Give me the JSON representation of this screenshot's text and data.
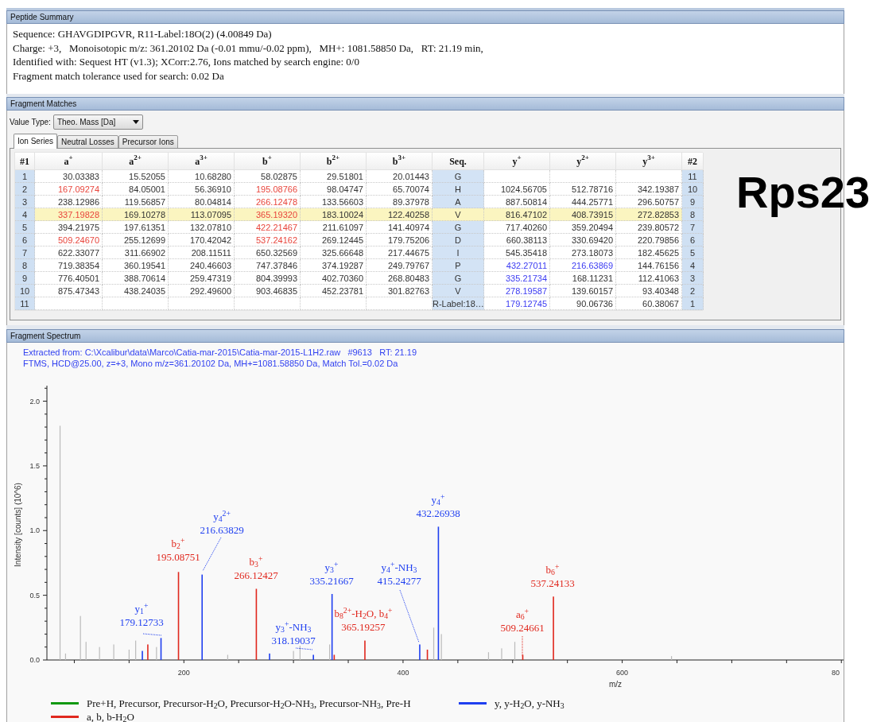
{
  "peptide_summary": {
    "title": "Peptide Summary",
    "lines": [
      "Sequence: GHAVGDIPGVR, R11-Label:18O(2) (4.00849 Da)",
      "Charge: +3,   Monoisotopic m/z: 361.20102 Da (-0.01 mmu/-0.02 ppm),   MH+: 1081.58850 Da,   RT: 21.19 min,",
      "Identified with: Sequest HT (v1.3); XCorr:2.76, Ions matched by search engine: 0/0",
      "Fragment match tolerance used for search: 0.02 Da"
    ]
  },
  "fragment_matches": {
    "title": "Fragment Matches",
    "value_type": {
      "label": "Value Type:",
      "value": "Theo. Mass [Da]"
    },
    "tabs": [
      {
        "label": "Ion Series",
        "selected": true
      },
      {
        "label": "Neutral Losses",
        "selected": false
      },
      {
        "label": "Precursor Ions",
        "selected": false
      }
    ],
    "table": {
      "columns": [
        {
          "label": "#1",
          "kind": "index"
        },
        {
          "label": "a$^{+}$",
          "kind": "a"
        },
        {
          "label": "a$^{2+}$",
          "kind": "a"
        },
        {
          "label": "a$^{3+}$",
          "kind": "a"
        },
        {
          "label": "b$^{+}$",
          "kind": "b"
        },
        {
          "label": "b$^{2+}$",
          "kind": "b"
        },
        {
          "label": "b$^{3+}$",
          "kind": "b"
        },
        {
          "label": "Seq.",
          "kind": "seq"
        },
        {
          "label": "y$^{+}$",
          "kind": "y"
        },
        {
          "label": "y$^{2+}$",
          "kind": "y"
        },
        {
          "label": "y$^{3+}$",
          "kind": "y"
        },
        {
          "label": "#2",
          "kind": "index"
        }
      ],
      "rows": [
        {
          "number": "1",
          "selected": false,
          "a": [
            {
              "value": "30.03383",
              "matched": false
            },
            {
              "value": "15.52055",
              "matched": false
            },
            {
              "value": "10.68280",
              "matched": false
            }
          ],
          "b": [
            {
              "value": "58.02875",
              "matched": false
            },
            {
              "value": "29.51801",
              "matched": false
            },
            {
              "value": "20.01443",
              "matched": false
            }
          ],
          "seq": "G",
          "number_rev": "11"
        },
        {
          "number": "2",
          "selected": false,
          "a": [
            {
              "value": "167.09274",
              "matched": true
            },
            {
              "value": "84.05001",
              "matched": false
            },
            {
              "value": "56.36910",
              "matched": false
            }
          ],
          "b": [
            {
              "value": "195.08766",
              "matched": true
            },
            {
              "value": "98.04747",
              "matched": false
            },
            {
              "value": "65.70074",
              "matched": false
            }
          ],
          "seq": "H",
          "y": [
            {
              "value": "1024.56705",
              "matched": false
            },
            {
              "value": "512.78716",
              "matched": false
            },
            {
              "value": "342.19387",
              "matched": false
            }
          ],
          "number_rev": "10"
        },
        {
          "number": "3",
          "selected": false,
          "a": [
            {
              "value": "238.12986",
              "matched": false
            },
            {
              "value": "119.56857",
              "matched": false
            },
            {
              "value": "80.04814",
              "matched": false
            }
          ],
          "b": [
            {
              "value": "266.12478",
              "matched": true
            },
            {
              "value": "133.56603",
              "matched": false
            },
            {
              "value": "89.37978",
              "matched": false
            }
          ],
          "seq": "A",
          "y": [
            {
              "value": "887.50814",
              "matched": false
            },
            {
              "value": "444.25771",
              "matched": false
            },
            {
              "value": "296.50757",
              "matched": false
            }
          ],
          "number_rev": "9"
        },
        {
          "number": "4",
          "selected": true,
          "a": [
            {
              "value": "337.19828",
              "matched": true
            },
            {
              "value": "169.10278",
              "matched": false
            },
            {
              "value": "113.07095",
              "matched": false
            }
          ],
          "b": [
            {
              "value": "365.19320",
              "matched": true
            },
            {
              "value": "183.10024",
              "matched": false
            },
            {
              "value": "122.40258",
              "matched": false
            }
          ],
          "seq": "V",
          "y": [
            {
              "value": "816.47102",
              "matched": false
            },
            {
              "value": "408.73915",
              "matched": false
            },
            {
              "value": "272.82853",
              "matched": false
            }
          ],
          "number_rev": "8"
        },
        {
          "number": "5",
          "selected": false,
          "a": [
            {
              "value": "394.21975",
              "matched": false
            },
            {
              "value": "197.61351",
              "matched": false
            },
            {
              "value": "132.07810",
              "matched": false
            }
          ],
          "b": [
            {
              "value": "422.21467",
              "matched": true
            },
            {
              "value": "211.61097",
              "matched": false
            },
            {
              "value": "141.40974",
              "matched": false
            }
          ],
          "seq": "G",
          "y": [
            {
              "value": "717.40260",
              "matched": false
            },
            {
              "value": "359.20494",
              "matched": false
            },
            {
              "value": "239.80572",
              "matched": false
            }
          ],
          "number_rev": "7"
        },
        {
          "number": "6",
          "selected": false,
          "a": [
            {
              "value": "509.24670",
              "matched": true
            },
            {
              "value": "255.12699",
              "matched": false
            },
            {
              "value": "170.42042",
              "matched": false
            }
          ],
          "b": [
            {
              "value": "537.24162",
              "matched": true
            },
            {
              "value": "269.12445",
              "matched": false
            },
            {
              "value": "179.75206",
              "matched": false
            }
          ],
          "seq": "D",
          "y": [
            {
              "value": "660.38113",
              "matched": false
            },
            {
              "value": "330.69420",
              "matched": false
            },
            {
              "value": "220.79856",
              "matched": false
            }
          ],
          "number_rev": "6"
        },
        {
          "number": "7",
          "selected": false,
          "a": [
            {
              "value": "622.33077",
              "matched": false
            },
            {
              "value": "311.66902",
              "matched": false
            },
            {
              "value": "208.11511",
              "matched": false
            }
          ],
          "b": [
            {
              "value": "650.32569",
              "matched": false
            },
            {
              "value": "325.66648",
              "matched": false
            },
            {
              "value": "217.44675",
              "matched": false
            }
          ],
          "seq": "I",
          "y": [
            {
              "value": "545.35418",
              "matched": false
            },
            {
              "value": "273.18073",
              "matched": false
            },
            {
              "value": "182.45625",
              "matched": false
            }
          ],
          "number_rev": "5"
        },
        {
          "number": "8",
          "selected": false,
          "a": [
            {
              "value": "719.38354",
              "matched": false
            },
            {
              "value": "360.19541",
              "matched": false
            },
            {
              "value": "240.46603",
              "matched": false
            }
          ],
          "b": [
            {
              "value": "747.37846",
              "matched": false
            },
            {
              "value": "374.19287",
              "matched": false
            },
            {
              "value": "249.79767",
              "matched": false
            }
          ],
          "seq": "P",
          "y": [
            {
              "value": "432.27011",
              "matched": true
            },
            {
              "value": "216.63869",
              "matched": true
            },
            {
              "value": "144.76156",
              "matched": false
            }
          ],
          "number_rev": "4"
        },
        {
          "number": "9",
          "selected": false,
          "a": [
            {
              "value": "776.40501",
              "matched": false
            },
            {
              "value": "388.70614",
              "matched": false
            },
            {
              "value": "259.47319",
              "matched": false
            }
          ],
          "b": [
            {
              "value": "804.39993",
              "matched": false
            },
            {
              "value": "402.70360",
              "matched": false
            },
            {
              "value": "268.80483",
              "matched": false
            }
          ],
          "seq": "G",
          "y": [
            {
              "value": "335.21734",
              "matched": true
            },
            {
              "value": "168.11231",
              "matched": false
            },
            {
              "value": "112.41063",
              "matched": false
            }
          ],
          "number_rev": "3"
        },
        {
          "number": "10",
          "selected": false,
          "a": [
            {
              "value": "875.47343",
              "matched": false
            },
            {
              "value": "438.24035",
              "matched": false
            },
            {
              "value": "292.49600",
              "matched": false
            }
          ],
          "b": [
            {
              "value": "903.46835",
              "matched": false
            },
            {
              "value": "452.23781",
              "matched": false
            },
            {
              "value": "301.82763",
              "matched": false
            }
          ],
          "seq": "V",
          "y": [
            {
              "value": "278.19587",
              "matched": true
            },
            {
              "value": "139.60157",
              "matched": false
            },
            {
              "value": "93.40348",
              "matched": false
            }
          ],
          "number_rev": "2"
        },
        {
          "number": "11",
          "selected": false,
          "seq": "R-Label:18…",
          "y": [
            {
              "value": "179.12745",
              "matched": true
            },
            {
              "value": "90.06736",
              "matched": false
            },
            {
              "value": "60.38067",
              "matched": false
            }
          ],
          "number_rev": "1"
        }
      ]
    }
  },
  "annotation_label": "Rps23",
  "fragment_spectrum": {
    "title": "Fragment Spectrum",
    "info_lines": [
      "Extracted from: C:\\Xcalibur\\data\\Marco\\Catia-mar-2015\\Catia-mar-2015-L1H2.raw   #9613   RT: 21.19",
      "FTMS, HCD@25.00, z=+3, Mono m/z=361.20102 Da, MH+=1081.58850 Da, Match Tol.=0.02 Da"
    ],
    "chart_data": {
      "type": "bar",
      "xlabel": "m/z",
      "ylabel": "Intensity [counts] (10^6)",
      "xlim": [
        75,
        802
      ],
      "ylim": [
        0,
        2.12
      ],
      "xticks": [
        200,
        400,
        600
      ],
      "legend": "bottom",
      "yticks": [
        {
          "value": 0,
          "label": "0.0"
        },
        {
          "value": 0.5,
          "label": "0.5"
        },
        {
          "value": 1,
          "label": "1.0"
        },
        {
          "value": 1.5,
          "label": "1.5"
        },
        {
          "value": 2,
          "label": "2.0"
        }
      ],
      "x": [
        87.0,
        92.0,
        105.6,
        110.7,
        123.0,
        136.0,
        150.0,
        156.0,
        162.1,
        167.09,
        175.0,
        179.13,
        195.09,
        216.64,
        240.0,
        266.12,
        278.2,
        300.0,
        306.0,
        318.19,
        333.0,
        335.22,
        337.2,
        365.19,
        415.24,
        422.21,
        428.0,
        432.27,
        435.0,
        478.0,
        490.0,
        502.0,
        509.25,
        537.24,
        645.0
      ],
      "series": [
        {
          "name": "Pre+H, Precursor, Precursor-H$_{2}$O, Precursor-H$_{2}$O-NH$_{3}$, Precursor-NH$_{3}$, Pre-H",
          "color": "#119911",
          "values": [
            null,
            null,
            null,
            null,
            null,
            null,
            null,
            null,
            null,
            null,
            null,
            null,
            null,
            null,
            null,
            null,
            null,
            null,
            null,
            null,
            null,
            null,
            null,
            null,
            null,
            null,
            null,
            null,
            null,
            null,
            null,
            null,
            null,
            null,
            null
          ]
        },
        {
          "name": "y, y-H$_{2}$O, y-NH$_{3}$",
          "color": "#1f3ff0",
          "values": [
            null,
            null,
            null,
            null,
            null,
            null,
            null,
            null,
            0.07,
            null,
            null,
            0.17,
            null,
            0.66,
            null,
            null,
            0.05,
            null,
            null,
            0.04,
            null,
            0.51,
            null,
            null,
            0.12,
            null,
            null,
            1.03,
            null,
            null,
            null,
            null,
            null,
            null,
            null
          ]
        },
        {
          "name": "a, b, b-H$_{2}$O",
          "color": "#e0281e",
          "values": [
            null,
            null,
            null,
            null,
            null,
            null,
            null,
            null,
            null,
            0.12,
            null,
            null,
            0.68,
            null,
            null,
            0.55,
            null,
            null,
            null,
            null,
            null,
            null,
            0.04,
            0.15,
            null,
            0.08,
            null,
            null,
            null,
            null,
            null,
            null,
            0.04,
            0.49,
            null
          ]
        },
        {
          "color": "#bbbbbb",
          "values": [
            1.81,
            0.05,
            0.34,
            0.14,
            0.1,
            0.12,
            0.08,
            0.15,
            null,
            null,
            0.1,
            null,
            null,
            null,
            0.04,
            null,
            null,
            0.07,
            0.11,
            null,
            0.12,
            null,
            null,
            null,
            null,
            null,
            0.25,
            null,
            0.2,
            0.06,
            0.09,
            0.14,
            null,
            null,
            0.03
          ]
        }
      ]
    },
    "cut_tick_label": "80",
    "peak_labels": [
      {
        "kind": "y",
        "ion": "y$_{1}$$^{+}$",
        "mz": "179.12733"
      },
      {
        "kind": "b",
        "ion": "b$_{2}$$^{+}$",
        "mz": "195.08751"
      },
      {
        "kind": "y",
        "ion": "y$_{4}$$^{2+}$",
        "mz": "216.63829"
      },
      {
        "kind": "b",
        "ion": "b$_{3}$$^{+}$",
        "mz": "266.12427"
      },
      {
        "kind": "y",
        "ion": "y$_{3}$$^{+}$-NH$_{3}$",
        "mz": "318.19037"
      },
      {
        "kind": "y",
        "ion": "y$_{3}$$^{+}$",
        "mz": "335.21667"
      },
      {
        "kind": "b",
        "ion": "b$_{8}$$^{2+}$-H$_{2}$O, b$_{4}$$^{+}$",
        "mz": "365.19257"
      },
      {
        "kind": "y",
        "ion": "y$_{4}$$^{+}$-NH$_{3}$",
        "mz": "415.24277"
      },
      {
        "kind": "y",
        "ion": "y$_{4}$$^{+}$",
        "mz": "432.26938"
      },
      {
        "kind": "b",
        "ion": "a$_{6}$$^{+}$",
        "mz": "509.24661"
      },
      {
        "kind": "b",
        "ion": "b$_{6}$$^{+}$",
        "mz": "537.24133"
      }
    ]
  }
}
